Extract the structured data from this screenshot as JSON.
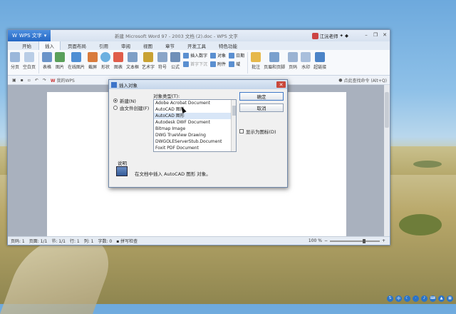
{
  "app": {
    "menu_label": "WPS 文字",
    "doc_title": "新建 Microsoft Word 97 - 2003 文档 (2).doc - WPS 文字",
    "user_name": "江沅老师"
  },
  "tabs": [
    "开始",
    "插入",
    "页面布局",
    "引用",
    "审阅",
    "视图",
    "章节",
    "开发工具",
    "特色功能"
  ],
  "active_tab": "插入",
  "ribbon": {
    "buttons": [
      "分页",
      "空白页",
      "表格",
      "图片",
      "在线图片",
      "截屏",
      "形状",
      "图表",
      "文本框",
      "艺术字",
      "符号",
      "公式",
      "批注",
      "页眉和页脚",
      "页码",
      "水印",
      "超链接"
    ],
    "small_group_1": [
      "插入数字",
      "对象",
      "日期"
    ],
    "small_group_2": [
      "首字下沉",
      "附件",
      "域"
    ]
  },
  "quickbar": {
    "wps_tab": "我的WPS",
    "command_search": "点此查找命令 (Alt+Q)"
  },
  "status": {
    "page": "页码: 1",
    "pages": "页面: 1/1",
    "section": "节: 1/1",
    "row": "行: 1",
    "col": "列: 1",
    "words": "字数: 0",
    "spell": "拼写检查",
    "zoom": "100 %"
  },
  "dialog": {
    "title": "插入对象",
    "radio_new": "新建(N)",
    "radio_file": "由文件创建(F)",
    "type_label": "对象类型(T):",
    "object_types": [
      "Adobe Acrobat Document",
      "AutoCAD 图形",
      "AutoCAD 图形",
      "Autodesk DWF Document",
      "Bitmap Image",
      "DWG TrueView Drawing",
      "DWGOLEServerStub.Document",
      "Foxit PDF Document"
    ],
    "selected_index": 2,
    "ok": "确定",
    "cancel": "取消",
    "show_as_icon": "显示为图标(D)",
    "desc_label": "说明",
    "desc_text": "在文档中插入 AutoCAD 图形 对象。"
  }
}
